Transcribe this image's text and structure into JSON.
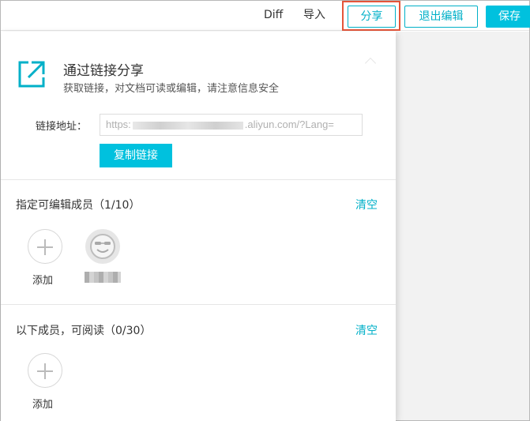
{
  "toolbar": {
    "diff_label": "Diff",
    "import_label": "导入",
    "share_label": "分享",
    "exit_edit_label": "退出编辑",
    "save_label": "保存"
  },
  "share_panel": {
    "title": "通过链接分享",
    "description": "获取链接，对文档可读或编辑，请注意信息安全",
    "link_label": "链接地址：",
    "link_value_prefix": "https:",
    "link_value_suffix": ".aliyun.com/?Lang=",
    "copy_button": "复制链接",
    "editors": {
      "title": "指定可编辑成员（1/10）",
      "clear_label": "清空",
      "add_label": "添加"
    },
    "readers": {
      "title": "以下成员，可阅读（0/30）",
      "clear_label": "清空",
      "add_label": "添加"
    }
  },
  "colors": {
    "accent": "#00c1de",
    "accent_text": "#00b0c8",
    "highlight": "#e4553a"
  }
}
